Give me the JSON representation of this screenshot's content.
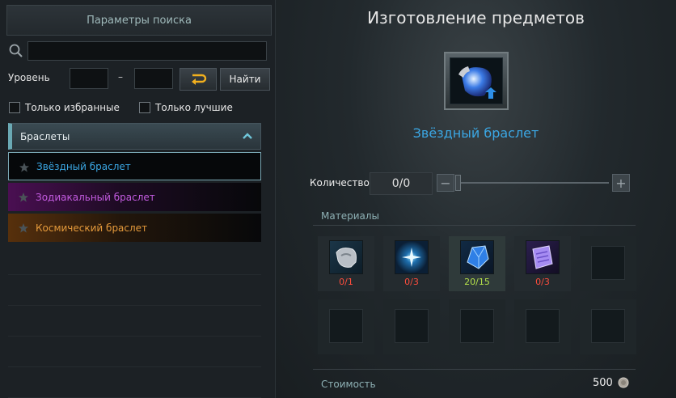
{
  "search": {
    "header": "Параметры поиска",
    "query": "",
    "level_label": "Уровень",
    "level_min": "",
    "level_max": "",
    "level_dash": "–",
    "find_label": "Найти",
    "favorites_label": "Только избранные",
    "best_label": "Только лучшие"
  },
  "category": {
    "label": "Браслеты"
  },
  "items": [
    {
      "name": "Звёздный браслет",
      "rarity": "blue",
      "selected": true
    },
    {
      "name": "Зодиакальный браслет",
      "rarity": "purple",
      "selected": false
    },
    {
      "name": "Космический браслет",
      "rarity": "orange",
      "selected": false
    }
  ],
  "crafting": {
    "title": "Изготовление предметов",
    "item_name": "Звёздный браслет",
    "quantity_label": "Количество",
    "quantity_value": "0/0",
    "quantity_minus": "−",
    "quantity_plus": "+",
    "materials_label": "Материалы",
    "materials": [
      {
        "count": "0/1",
        "status": "insufficient",
        "icon": "silver-bracelet-icon"
      },
      {
        "count": "0/3",
        "status": "insufficient",
        "icon": "spark-icon"
      },
      {
        "count": "20/15",
        "status": "sufficient",
        "icon": "blue-crystal-icon"
      },
      {
        "count": "0/3",
        "status": "insufficient",
        "icon": "scroll-icon"
      }
    ],
    "cost_label": "Стоимость",
    "cost_value": "500"
  },
  "colors": {
    "rarity_blue": "#3ba7e4",
    "rarity_purple": "#c35be0",
    "rarity_orange": "#e59a3b",
    "insufficient": "#ff4d3d",
    "sufficient": "#b4e04a"
  }
}
